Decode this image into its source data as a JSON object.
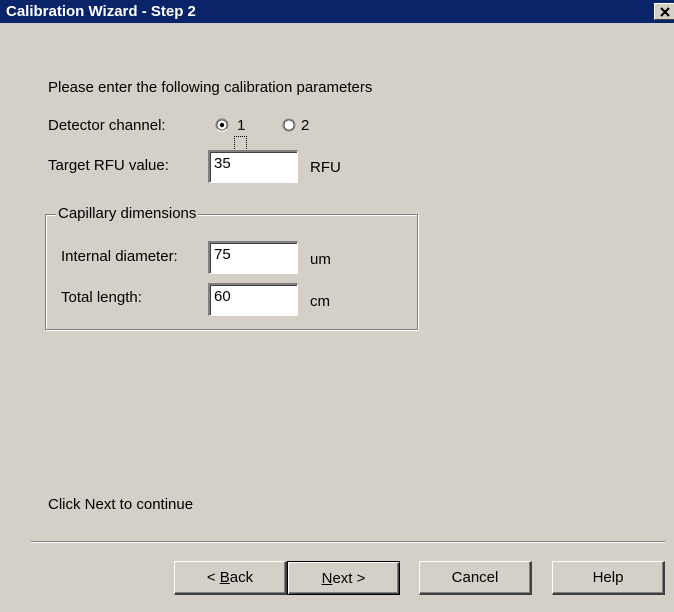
{
  "window": {
    "title": "Calibration Wizard - Step 2",
    "close_glyph": "✕"
  },
  "instructions": "Please enter the following calibration parameters",
  "detector": {
    "label": "Detector channel:",
    "options": [
      {
        "label": "1",
        "selected": true
      },
      {
        "label": "2",
        "selected": false
      }
    ]
  },
  "target_rfu": {
    "label": "Target RFU value:",
    "value": "35",
    "unit": "RFU"
  },
  "capillary": {
    "legend": "Capillary dimensions",
    "internal_diameter": {
      "label": "Internal diameter:",
      "value": "75",
      "unit": "um"
    },
    "total_length": {
      "label": "Total length:",
      "value": "60",
      "unit": "cm"
    }
  },
  "footer_text": "Click Next to continue",
  "buttons": {
    "back": {
      "mnemonic": "B",
      "rest": "ack",
      "prefix": "< "
    },
    "next": {
      "mnemonic": "N",
      "rest": "ext",
      "suffix": " >"
    },
    "cancel": "Cancel",
    "help": "Help"
  },
  "colors": {
    "titlebar": "#0a246a",
    "dialog_face": "#d4d0c8"
  },
  "icons": {
    "close": "close-icon",
    "radio_selected": "radio-selected-icon",
    "radio_unselected": "radio-unselected-icon"
  }
}
